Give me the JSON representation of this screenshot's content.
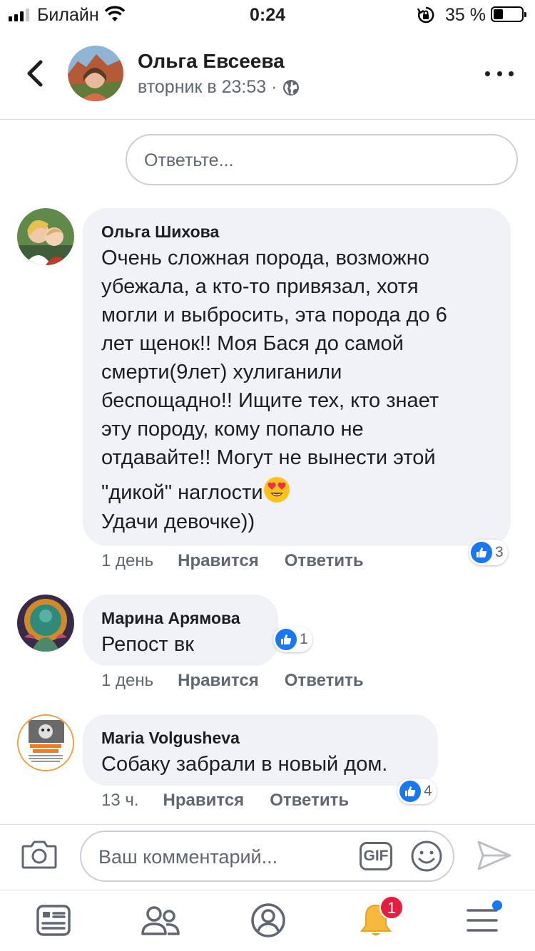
{
  "status_bar": {
    "carrier": "Билайн",
    "time": "0:24",
    "battery_percent": "35 %"
  },
  "header": {
    "name": "Ольга Евсеева",
    "subtitle": "вторник в 23:53 ·"
  },
  "reply_box": {
    "placeholder": "Ответьте..."
  },
  "comments": [
    {
      "author": "Ольга Шихова",
      "lines": [
        "Очень сложная порода, возможно",
        "убежала, а кто-то привязал, хотя",
        "могли и выбросить, эта порода до 6",
        "лет щенок!! Моя Бася до самой",
        "смерти(9лет) хулиганили",
        "беспощадно!! Ищите тех, кто знает",
        "эту породу, кому попало не",
        "отдавайте!! Могут не вынести этой",
        "\"дикой\" наглости",
        "Удачи девочке))"
      ],
      "time": "1 день",
      "like_label": "Нравится",
      "reply_label": "Ответить",
      "reactions": "3"
    },
    {
      "author": "Марина Арямова",
      "lines": [
        "Репост вк"
      ],
      "time": "1 день",
      "like_label": "Нравится",
      "reply_label": "Ответить",
      "reactions": "1"
    },
    {
      "author": "Maria Volgusheva",
      "lines": [
        "Собаку забрали в новый дом."
      ],
      "time": "13 ч.",
      "like_label": "Нравится",
      "reply_label": "Ответить",
      "reactions": "4"
    }
  ],
  "composer": {
    "placeholder": "Ваш комментарий...",
    "gif_label": "GIF"
  },
  "tabbar": {
    "notifications_badge": "1"
  },
  "colors": {
    "accent": "#1877f2",
    "badge": "#e41e3f",
    "bubble": "#f0f2f5",
    "secondary_text": "#606770"
  }
}
